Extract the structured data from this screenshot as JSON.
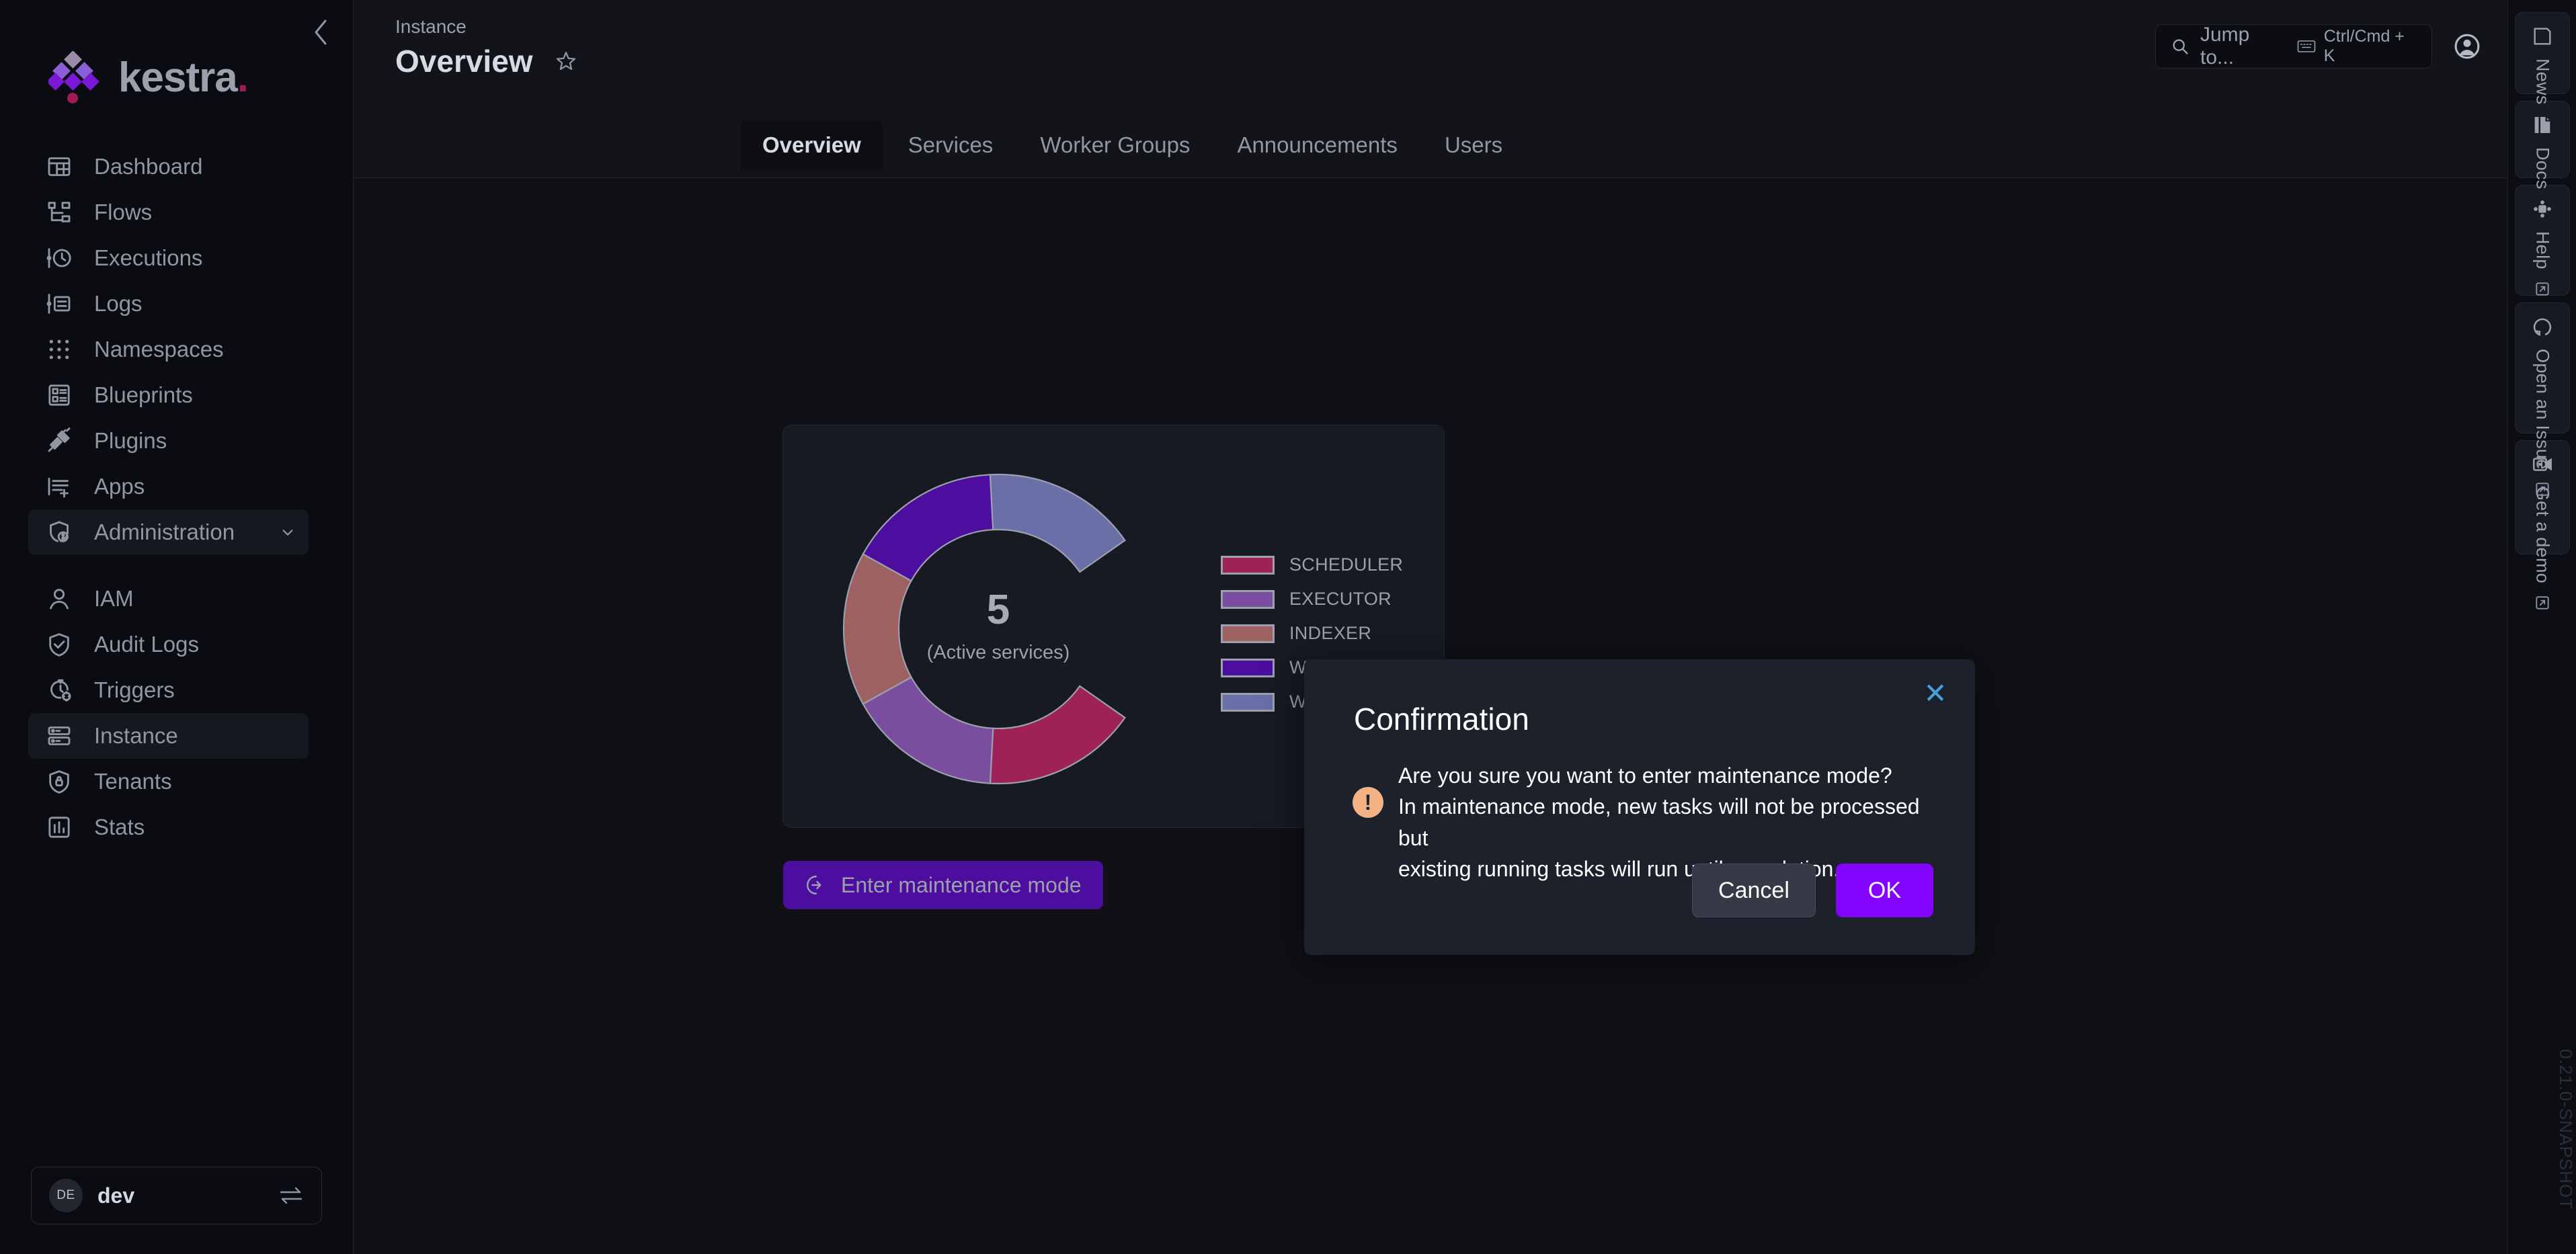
{
  "brand": {
    "name": "kestra",
    "dot": ".",
    "accent": "#8405ff",
    "logo_pink": "#a01b55"
  },
  "sidebar": {
    "collapse_icon": "chevron-left-icon",
    "items": [
      {
        "label": "Dashboard",
        "icon": "dashboard-icon",
        "active": false,
        "indent": false
      },
      {
        "label": "Flows",
        "icon": "flows-icon",
        "active": false,
        "indent": false
      },
      {
        "label": "Executions",
        "icon": "executions-icon",
        "active": false,
        "indent": false
      },
      {
        "label": "Logs",
        "icon": "logs-icon",
        "active": false,
        "indent": false
      },
      {
        "label": "Namespaces",
        "icon": "namespaces-icon",
        "active": false,
        "indent": false
      },
      {
        "label": "Blueprints",
        "icon": "blueprints-icon",
        "active": false,
        "indent": false
      },
      {
        "label": "Plugins",
        "icon": "plugins-icon",
        "active": false,
        "indent": false
      },
      {
        "label": "Apps",
        "icon": "apps-icon",
        "active": false,
        "indent": false
      },
      {
        "label": "Administration",
        "icon": "administration-icon",
        "active": true,
        "indent": false,
        "expandable": true
      },
      {
        "label": "IAM",
        "icon": "iam-icon",
        "active": false,
        "indent": true
      },
      {
        "label": "Audit Logs",
        "icon": "audit-logs-icon",
        "active": false,
        "indent": true
      },
      {
        "label": "Triggers",
        "icon": "triggers-icon",
        "active": false,
        "indent": true
      },
      {
        "label": "Instance",
        "icon": "instance-icon",
        "active": true,
        "indent": true
      },
      {
        "label": "Tenants",
        "icon": "tenants-icon",
        "active": false,
        "indent": true
      },
      {
        "label": "Stats",
        "icon": "stats-icon",
        "active": false,
        "indent": true
      }
    ],
    "tenant": {
      "initials": "DE",
      "name": "dev",
      "switch_icon": "swap-arrows-icon"
    }
  },
  "header": {
    "breadcrumb": "Instance",
    "title": "Overview",
    "star_icon": "star-outline-icon",
    "search": {
      "placeholder": "Jump to...",
      "shortcut": "Ctrl/Cmd + K",
      "search_icon": "search-icon",
      "keyboard_icon": "keyboard-icon"
    },
    "account_icon": "account-circle-icon"
  },
  "tabs": [
    {
      "label": "Overview",
      "active": true
    },
    {
      "label": "Services",
      "active": false
    },
    {
      "label": "Worker Groups",
      "active": false
    },
    {
      "label": "Announcements",
      "active": false
    },
    {
      "label": "Users",
      "active": false
    }
  ],
  "chart_data": {
    "type": "pie",
    "title": "",
    "center_value": "5",
    "center_label": "(Active services)",
    "legend_position": "right",
    "categories": [
      "SCHEDULER",
      "EXECUTOR",
      "INDEXER",
      "WEBSERVER",
      "WORKER"
    ],
    "values": [
      1,
      1,
      1,
      1,
      1
    ],
    "colors": [
      "#9e2258",
      "#7b4d9e",
      "#9e6161",
      "#4d0d9e",
      "#6b6fa8"
    ],
    "series": [
      {
        "name": "Active services",
        "values": [
          1,
          1,
          1,
          1,
          1
        ]
      }
    ]
  },
  "maintenance_button": {
    "label": "Enter maintenance mode",
    "icon": "enter-arrow-circle-icon"
  },
  "modal": {
    "title": "Confirmation",
    "close_icon": "close-icon",
    "warning_icon": "warning-exclamation-icon",
    "line1": "Are you sure you want to enter maintenance mode?",
    "line2": "In maintenance mode, new tasks will not be processed but",
    "line3": "existing running tasks will run until completion.",
    "cancel_label": "Cancel",
    "ok_label": "OK"
  },
  "right_rail": {
    "items": [
      {
        "label": "News",
        "icon": "news-icon",
        "external": false
      },
      {
        "label": "Docs",
        "icon": "docs-icon",
        "external": false
      },
      {
        "label": "Help",
        "icon": "slack-icon",
        "external": true
      },
      {
        "label": "Open an Issue",
        "icon": "github-icon",
        "external": true
      },
      {
        "label": "Get a demo",
        "icon": "demo-icon",
        "external": true
      }
    ],
    "version": "0.21.0-SNAPSHOT"
  }
}
